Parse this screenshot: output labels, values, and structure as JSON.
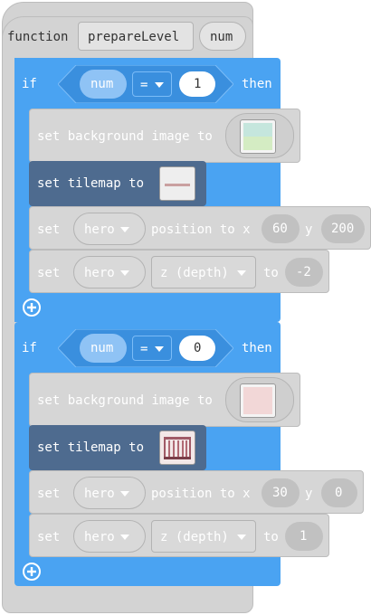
{
  "function_block": {
    "keyword": "function",
    "name": "prepareLevel",
    "param": "num"
  },
  "if_blocks": [
    {
      "if_label": "if",
      "then_label": "then",
      "compare": {
        "left": "num",
        "op": "=",
        "right": "1"
      },
      "statements": {
        "set_bg": "set background image to",
        "set_tilemap": "set tilemap to",
        "set_pos": {
          "set": "set",
          "sprite": "hero",
          "mid": "position to x",
          "x": "60",
          "y_label": "y",
          "y": "200"
        },
        "set_z": {
          "set": "set",
          "sprite": "hero",
          "prop": "z (depth)",
          "to": "to",
          "value": "-2"
        }
      },
      "colors": {
        "bg_thumb": "#c7e6d1",
        "tilemap_thumb": "#eeeeee"
      }
    },
    {
      "if_label": "if",
      "then_label": "then",
      "compare": {
        "left": "num",
        "op": "=",
        "right": "0"
      },
      "statements": {
        "set_bg": "set background image to",
        "set_tilemap": "set tilemap to",
        "set_pos": {
          "set": "set",
          "sprite": "hero",
          "mid": "position to x",
          "x": "30",
          "y_label": "y",
          "y": "0"
        },
        "set_z": {
          "set": "set",
          "sprite": "hero",
          "prop": "z (depth)",
          "to": "to",
          "value": "1"
        }
      },
      "colors": {
        "bg_thumb": "#f1d9d9",
        "tilemap_thumb": "#f3e8e8"
      }
    }
  ],
  "colors": {
    "logic_blue": "#4aa3f2",
    "sprite_gray": "#d6d6d6",
    "tilemap_dark": "#4e6b8f"
  }
}
